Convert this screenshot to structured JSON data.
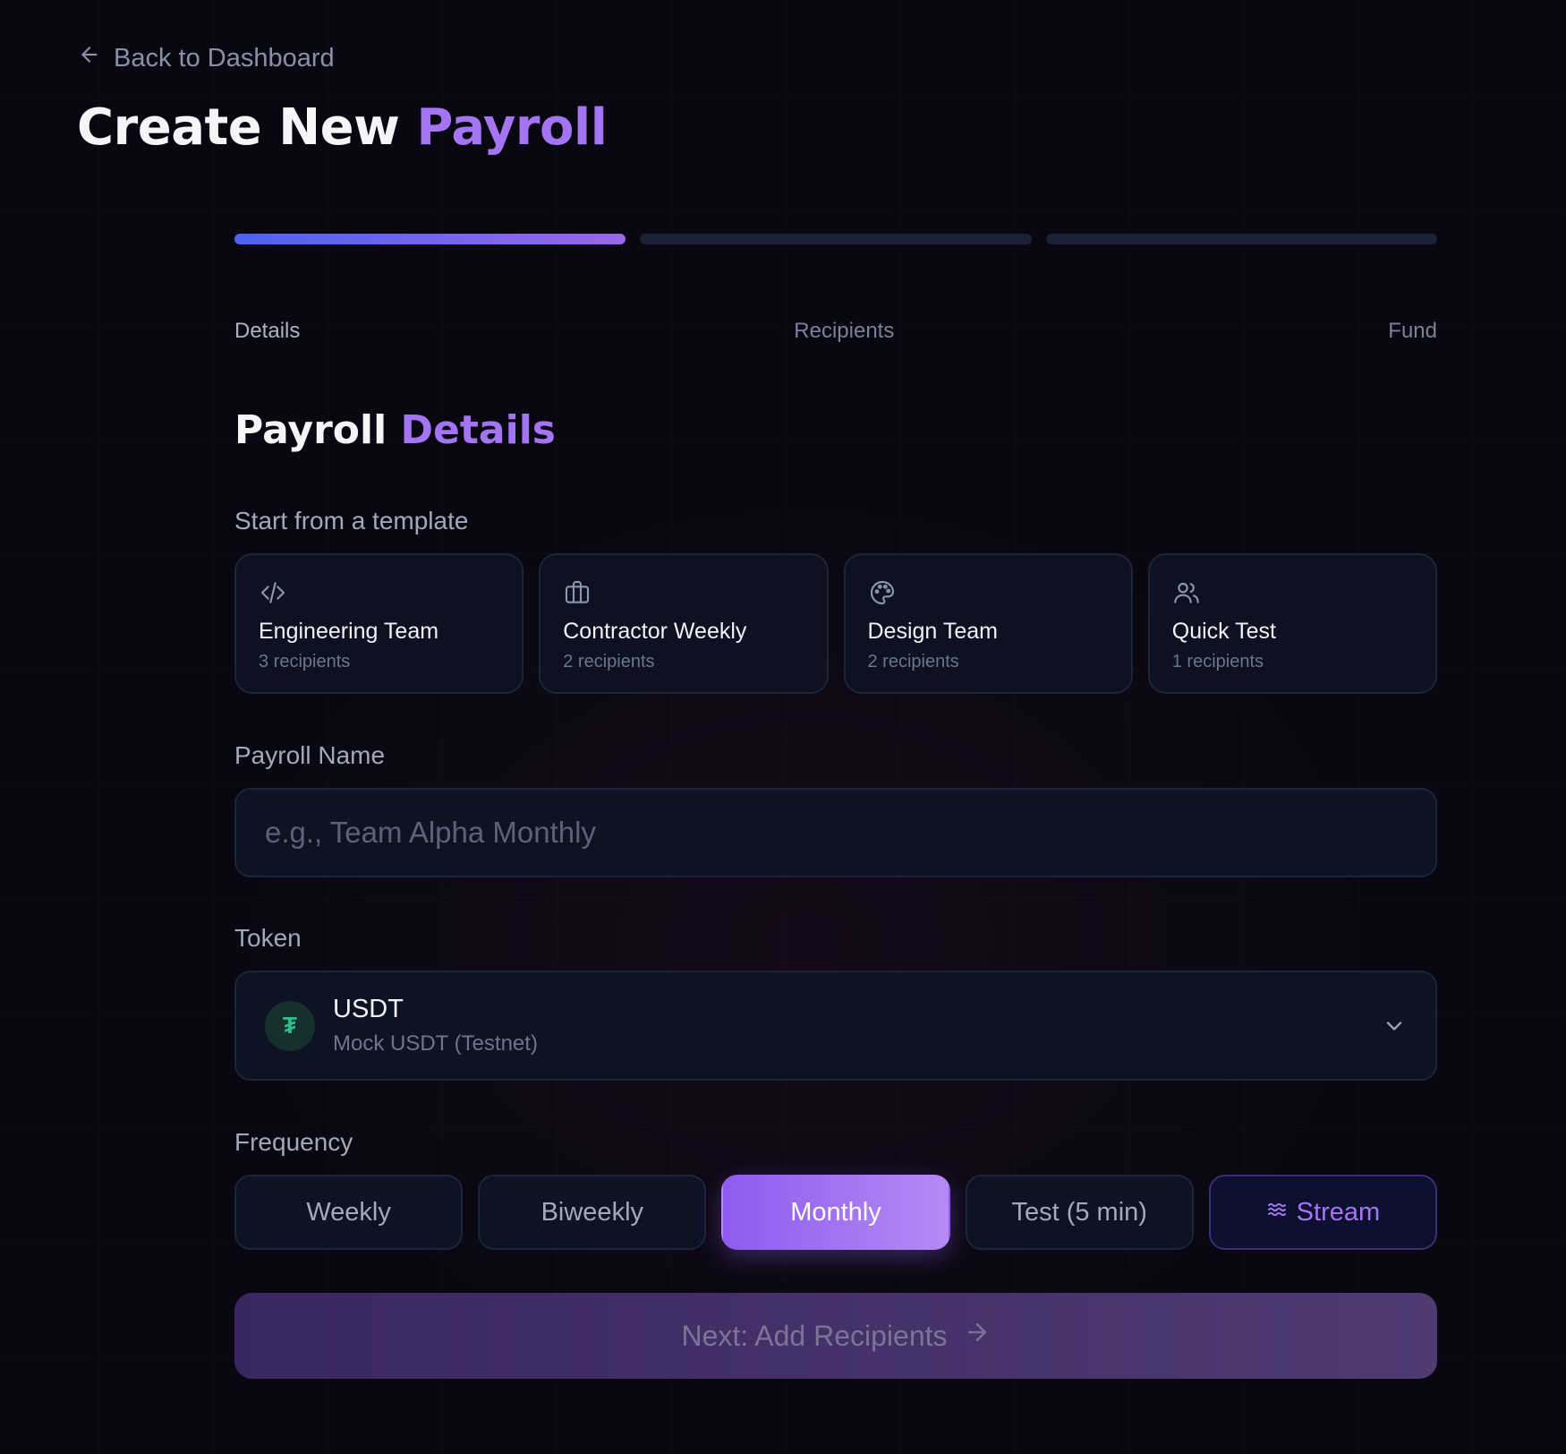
{
  "nav": {
    "back_label": "Back to Dashboard"
  },
  "header": {
    "title_main": "Create New",
    "title_accent": "Payroll"
  },
  "progress": {
    "current_step": 1,
    "total_steps": 3
  },
  "steps": [
    {
      "label": "Details"
    },
    {
      "label": "Recipients"
    },
    {
      "label": "Fund"
    }
  ],
  "section": {
    "title_main": "Payroll",
    "title_accent": "Details"
  },
  "templates": {
    "label": "Start from a template",
    "items": [
      {
        "icon": "code-icon",
        "name": "Engineering Team",
        "count": "3 recipients"
      },
      {
        "icon": "briefcase-icon",
        "name": "Contractor Weekly",
        "count": "2 recipients"
      },
      {
        "icon": "palette-icon",
        "name": "Design Team",
        "count": "2 recipients"
      },
      {
        "icon": "users-icon",
        "name": "Quick Test",
        "count": "1 recipients"
      }
    ]
  },
  "payroll_name": {
    "label": "Payroll Name",
    "placeholder": "e.g., Team Alpha Monthly",
    "value": ""
  },
  "token": {
    "label": "Token",
    "selected": {
      "symbol": "USDT",
      "description": "Mock USDT (Testnet)",
      "glyph": "₮"
    }
  },
  "frequency": {
    "label": "Frequency",
    "options": [
      {
        "label": "Weekly"
      },
      {
        "label": "Biweekly"
      },
      {
        "label": "Monthly"
      },
      {
        "label": "Test (5 min)"
      },
      {
        "label": "Stream"
      }
    ],
    "selected": "Monthly"
  },
  "next_button": {
    "label": "Next: Add Recipients"
  },
  "colors": {
    "background": "#090812",
    "accent": "#a475f2",
    "progress_gradient_start": "#4d63f0",
    "progress_gradient_end": "#9a67ea",
    "selected_gradient_start": "#8e5bef",
    "selected_gradient_end": "#b58af5",
    "usdt_green": "#2fbf8f"
  }
}
